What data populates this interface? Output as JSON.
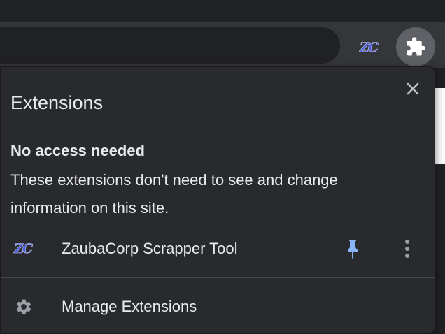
{
  "toolbar": {
    "extension_icon_label": "ZC",
    "extensions_button": "puzzle-icon"
  },
  "popup": {
    "title": "Extensions",
    "close_icon": "close-icon",
    "section": {
      "heading": "No access needed",
      "description": "These extensions don't need to see and change information on this site."
    },
    "extension": {
      "icon_label": "ZC",
      "name": "ZaubaCorp Scrapper Tool",
      "pin_icon": "pin-icon",
      "pin_color": "#8ab4f8",
      "more_icon": "more-vertical-icon"
    },
    "manage": {
      "label": "Manage Extensions",
      "icon": "gear-icon"
    }
  }
}
